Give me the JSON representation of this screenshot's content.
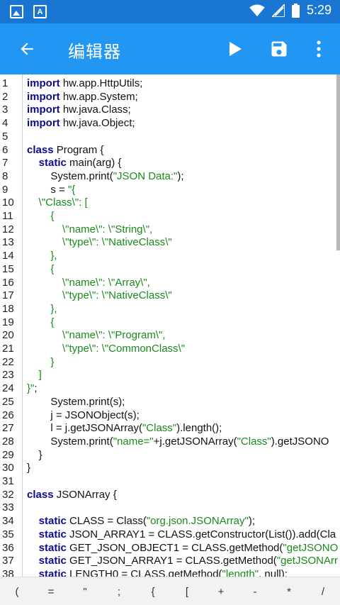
{
  "status_bar": {
    "time": "5:29",
    "left_icons": [
      "image-notification-icon",
      "font-a-notification-icon"
    ],
    "right_icons": [
      "wifi-icon",
      "signal-icon",
      "battery-icon"
    ],
    "color": "#1976D2"
  },
  "app_bar": {
    "title": "编辑器",
    "color": "#2196F3",
    "icons": [
      "back-arrow-icon",
      "play-icon",
      "save-icon",
      "more-vert-icon"
    ]
  },
  "editor": {
    "keyword_color": "#0b0b8c",
    "string_color": "#1a8a1a",
    "lines": [
      {
        "n": "1",
        "segs": [
          {
            "t": "import",
            "k": "kw"
          },
          {
            "t": " hw.app.HttpUtils;"
          }
        ]
      },
      {
        "n": "2",
        "segs": [
          {
            "t": "import",
            "k": "kw"
          },
          {
            "t": " hw.app.System;"
          }
        ]
      },
      {
        "n": "3",
        "segs": [
          {
            "t": "import",
            "k": "kw"
          },
          {
            "t": " hw.java.Class;"
          }
        ]
      },
      {
        "n": "4",
        "segs": [
          {
            "t": "import",
            "k": "kw"
          },
          {
            "t": " hw.java.Object;"
          }
        ]
      },
      {
        "n": "5",
        "segs": []
      },
      {
        "n": "6",
        "segs": [
          {
            "t": "class",
            "k": "kw"
          },
          {
            "t": " Program {"
          }
        ]
      },
      {
        "n": "7",
        "segs": [
          {
            "t": "    "
          },
          {
            "t": "static",
            "k": "kw"
          },
          {
            "t": " main(arg) {"
          }
        ]
      },
      {
        "n": "8",
        "segs": [
          {
            "t": "        System.print("
          },
          {
            "t": "\"JSON Data:\"",
            "k": "str"
          },
          {
            "t": ");"
          }
        ]
      },
      {
        "n": "9",
        "segs": [
          {
            "t": "        s = "
          },
          {
            "t": "\"{",
            "k": "str"
          }
        ]
      },
      {
        "n": "10",
        "segs": [
          {
            "t": "    \\\"Class\\\": [",
            "k": "str"
          }
        ]
      },
      {
        "n": "11",
        "segs": [
          {
            "t": "        {",
            "k": "str"
          }
        ]
      },
      {
        "n": "12",
        "segs": [
          {
            "t": "            \\\"name\\\": \\\"String\\\",",
            "k": "str"
          }
        ]
      },
      {
        "n": "13",
        "segs": [
          {
            "t": "            \\\"type\\\": \\\"NativeClass\\\"",
            "k": "str"
          }
        ]
      },
      {
        "n": "14",
        "segs": [
          {
            "t": "        },",
            "k": "str"
          }
        ]
      },
      {
        "n": "15",
        "segs": [
          {
            "t": "        {",
            "k": "str"
          }
        ]
      },
      {
        "n": "16",
        "segs": [
          {
            "t": "            \\\"name\\\": \\\"Array\\\",",
            "k": "str"
          }
        ]
      },
      {
        "n": "17",
        "segs": [
          {
            "t": "            \\\"type\\\": \\\"NativeClass\\\"",
            "k": "str"
          }
        ]
      },
      {
        "n": "18",
        "segs": [
          {
            "t": "        },",
            "k": "str"
          }
        ]
      },
      {
        "n": "19",
        "segs": [
          {
            "t": "        {",
            "k": "str"
          }
        ]
      },
      {
        "n": "20",
        "segs": [
          {
            "t": "            \\\"name\\\": \\\"Program\\\",",
            "k": "str"
          }
        ]
      },
      {
        "n": "21",
        "segs": [
          {
            "t": "            \\\"type\\\": \\\"CommonClass\\\"",
            "k": "str"
          }
        ]
      },
      {
        "n": "22",
        "segs": [
          {
            "t": "        }",
            "k": "str"
          }
        ]
      },
      {
        "n": "23",
        "segs": [
          {
            "t": "    ]",
            "k": "str"
          }
        ]
      },
      {
        "n": "24",
        "segs": [
          {
            "t": "}\"",
            "k": "str"
          },
          {
            "t": ";"
          }
        ]
      },
      {
        "n": "25",
        "segs": [
          {
            "t": "        System.print(s);"
          }
        ]
      },
      {
        "n": "26",
        "segs": [
          {
            "t": "        j = JSONObject(s);"
          }
        ]
      },
      {
        "n": "27",
        "segs": [
          {
            "t": "        l = j.getJSONArray("
          },
          {
            "t": "\"Class\"",
            "k": "str"
          },
          {
            "t": ").length();"
          }
        ]
      },
      {
        "n": "28",
        "segs": [
          {
            "t": "        System.print("
          },
          {
            "t": "\"name=\"",
            "k": "str"
          },
          {
            "t": "+j.getJSONArray("
          },
          {
            "t": "\"Class\"",
            "k": "str"
          },
          {
            "t": ").getJSONO"
          }
        ]
      },
      {
        "n": "29",
        "segs": [
          {
            "t": "    }"
          }
        ]
      },
      {
        "n": "30",
        "segs": [
          {
            "t": "}"
          }
        ]
      },
      {
        "n": "31",
        "segs": []
      },
      {
        "n": "32",
        "segs": [
          {
            "t": "class",
            "k": "kw"
          },
          {
            "t": " JSONArray {"
          }
        ]
      },
      {
        "n": "33",
        "segs": []
      },
      {
        "n": "34",
        "segs": [
          {
            "t": "    "
          },
          {
            "t": "static",
            "k": "kw"
          },
          {
            "t": " CLASS = Class("
          },
          {
            "t": "\"org.json.JSONArray\"",
            "k": "str"
          },
          {
            "t": ");"
          }
        ]
      },
      {
        "n": "35",
        "segs": [
          {
            "t": "    "
          },
          {
            "t": "static",
            "k": "kw"
          },
          {
            "t": " JSON_ARRAY1 = CLASS.getConstructor(List()).add(Cla"
          }
        ]
      },
      {
        "n": "36",
        "segs": [
          {
            "t": "    "
          },
          {
            "t": "static",
            "k": "kw"
          },
          {
            "t": " GET_JSON_OBJECT1 = CLASS.getMethod("
          },
          {
            "t": "\"getJSONO",
            "k": "str"
          }
        ]
      },
      {
        "n": "37",
        "segs": [
          {
            "t": "    "
          },
          {
            "t": "static",
            "k": "kw"
          },
          {
            "t": " GET_JSON_ARRAY1 = CLASS.getMethod("
          },
          {
            "t": "\"getJSONArr",
            "k": "str"
          }
        ]
      },
      {
        "n": "38",
        "segs": [
          {
            "t": "    "
          },
          {
            "t": "static",
            "k": "kw"
          },
          {
            "t": " LENGTH0 = CLASS.getMethod("
          },
          {
            "t": "\"length\"",
            "k": "str"
          },
          {
            "t": ", null);"
          }
        ]
      }
    ]
  },
  "symbol_bar": {
    "keys": [
      "(",
      "=",
      "\"",
      ";",
      "{",
      "[",
      "+",
      "-",
      "*",
      "/"
    ]
  }
}
